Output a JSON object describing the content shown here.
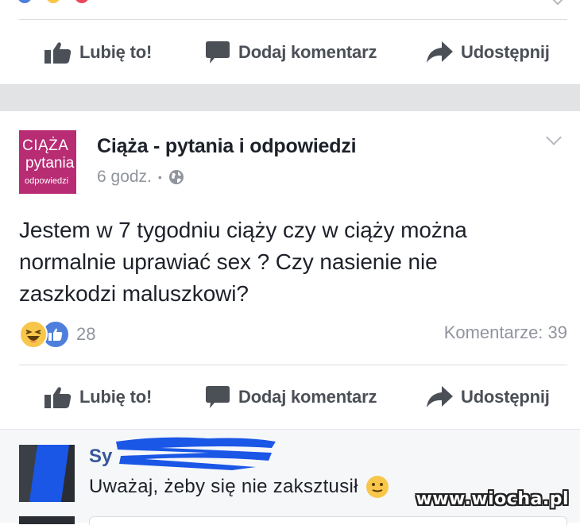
{
  "top_post": {
    "actions": {
      "like": "Lubię to!",
      "comment": "Dodaj komentarz",
      "share": "Udostępnij"
    }
  },
  "post": {
    "page_name": "Ciąża - pytania i odpowiedzi",
    "logo": {
      "line1": "CIĄŻA",
      "line2": "pytania",
      "line3": "odpowiedzi"
    },
    "time": "6 godz.",
    "separator": "•",
    "privacy_icon": "globe-icon",
    "text_lines": [
      "Jestem w 7 tygodniu ciąży czy w ciąży można",
      "normalnie uprawiać sex ? Czy nasienie nie",
      "zaszkodzi maluszkowi?"
    ],
    "reactions": {
      "icons": [
        "haha-icon",
        "like-icon"
      ],
      "count": "28"
    },
    "comment_count": "Komentarze: 39",
    "actions": {
      "like": "Lubię to!",
      "comment": "Dodaj komentarz",
      "share": "Udostępnij"
    }
  },
  "comment": {
    "name_visible": "Sy",
    "text": "Uważaj, żeby się nie zaksztusił",
    "emoji": "smile-emoji"
  },
  "watermark": "www.wiocha.pl",
  "colors": {
    "brand_logo": "#b82c74",
    "link_blue": "#365899",
    "like_blue": "#4e7fdc",
    "muted": "#90949c",
    "action_gray": "#4b4f56",
    "separator_band": "#e2e3e5"
  }
}
